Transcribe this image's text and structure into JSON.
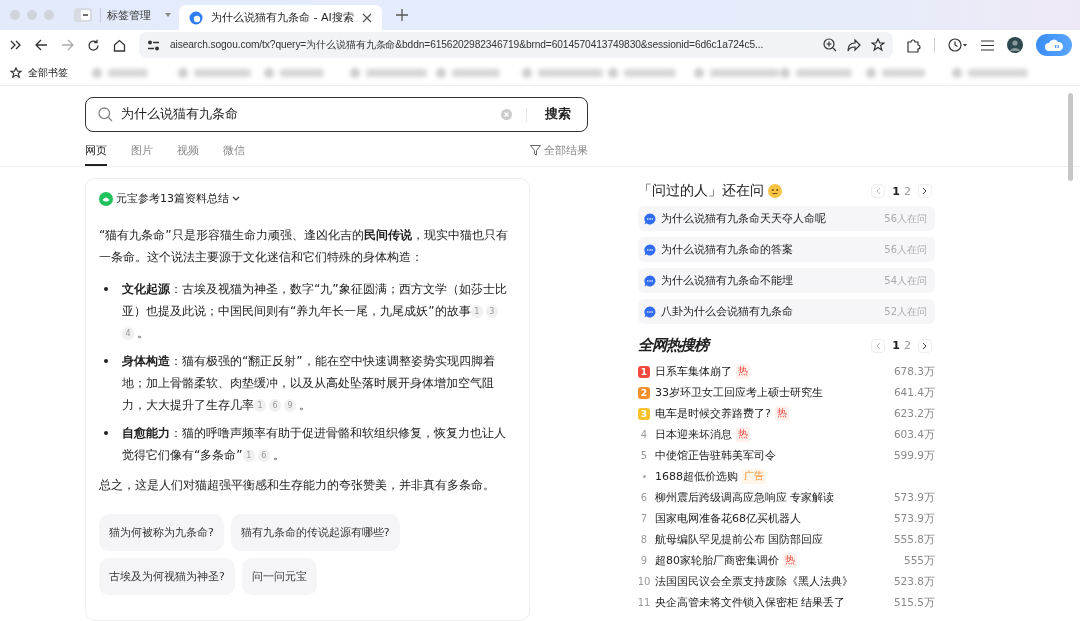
{
  "browser": {
    "tab_group": "标签管理",
    "tabs": [
      {
        "label": "为什么说猫有九条命 - AI搜索",
        "selected": true
      }
    ],
    "address": "aisearch.sogou.com/tx?query=为什么说猫有九条命&bddn=6156202982346719&brnd=6014570413749830&sessionid=6d6c1a724c5...",
    "bookmarks_label": "全部书签"
  },
  "search": {
    "value": "为什么说猫有九条命",
    "button": "搜索"
  },
  "filters": [
    {
      "label": "网页",
      "selected": true
    },
    {
      "label": "图片",
      "selected": false
    },
    {
      "label": "视频",
      "selected": false
    },
    {
      "label": "微信",
      "selected": false
    }
  ],
  "filter_all": "全部结果",
  "answer": {
    "header": "元宝参考13篇资料总结",
    "intro": "“猫有九条命”只是形容猫生命力顽强、逢凶化吉的**民间传说**，现实中猫也只有一条命。这个说法主要源于文化迷信和它们特殊的身体构造：",
    "bullets": [
      {
        "text": "**文化起源**：古埃及视猫为神圣，数字“九”象征圆满；西方文学（如莎士比亚）也提及此说；中国民间则有“养九年长一尾，九尾成妖”的故事",
        "refs": [
          "1",
          "3",
          "4"
        ],
        "end": "。"
      },
      {
        "text": "**身体构造**：猫有极强的“翻正反射”，能在空中快速调整姿势实现四脚着地；加上骨骼柔软、肉垫缓冲，以及从高处坠落时展开身体增加空气阻力，大大提升了生存几率",
        "refs": [
          "1",
          "6",
          "9"
        ],
        "end": "。"
      },
      {
        "text": "**自愈能力**：猫的呼噜声频率有助于促进骨骼和软组织修复，恢复力也让人觉得它们像有“多条命”",
        "refs": [
          "1",
          "6"
        ],
        "end": "。"
      }
    ],
    "summary": "总之，这是人们对猫超强平衡感和生存能力的夸张赞美，并非真有多条命。",
    "followups": [
      "猫为何被称为九条命?",
      "猫有九条命的传说起源有哪些?",
      "古埃及为何视猫为神圣?",
      "问一问元宝"
    ]
  },
  "asked": {
    "title": "「问过的人」还在问",
    "pages": [
      {
        "label": "1",
        "selected": true
      },
      {
        "label": "2",
        "selected": false
      }
    ],
    "items": [
      {
        "text": "为什么说猫有九条命天天夺人命呢",
        "count": "56人在问"
      },
      {
        "text": "为什么说猫有九条命的答案",
        "count": "56人在问"
      },
      {
        "text": "为什么说猫有九条命不能埋",
        "count": "54人在问"
      },
      {
        "text": "八卦为什么会说猫有九条命",
        "count": "52人在问"
      }
    ]
  },
  "hot": {
    "title": "全网热搜榜",
    "pages": [
      {
        "label": "1",
        "selected": true
      },
      {
        "label": "2",
        "selected": false
      }
    ],
    "items": [
      {
        "kind": "top",
        "rank": "1",
        "color": "#f04a3e",
        "text": "日系车集体崩了",
        "badge": "热",
        "count": "678.3万"
      },
      {
        "kind": "top",
        "rank": "2",
        "color": "#f7902b",
        "text": "33岁环卫女工回应考上硕士研究生",
        "count": "641.4万"
      },
      {
        "kind": "top",
        "rank": "3",
        "color": "#f7c22b",
        "text": "电车是时候交养路费了?",
        "badge": "热",
        "count": "623.2万"
      },
      {
        "kind": "plain",
        "rank": "4",
        "text": "日本迎来坏消息",
        "badge": "热",
        "count": "603.4万"
      },
      {
        "kind": "plain",
        "rank": "5",
        "text": "中使馆正告驻韩美军司令",
        "count": "599.9万"
      },
      {
        "kind": "ad",
        "text": "1688超低价选购",
        "badge": "广告"
      },
      {
        "kind": "plain",
        "rank": "6",
        "text": "柳州震后跨级调高应急响应 专家解读",
        "count": "573.9万"
      },
      {
        "kind": "plain",
        "rank": "7",
        "text": "国家电网准备花68亿买机器人",
        "count": "573.9万"
      },
      {
        "kind": "plain",
        "rank": "8",
        "text": "航母编队罕见提前公布 国防部回应",
        "count": "555.8万"
      },
      {
        "kind": "plain",
        "rank": "9",
        "text": "超80家轮胎厂商密集调价",
        "badge": "热",
        "count": "555万"
      },
      {
        "kind": "plain",
        "rank": "10",
        "text": "法国国民议会全票支持废除《黑人法典》",
        "count": "523.8万"
      },
      {
        "kind": "plain",
        "rank": "11",
        "text": "央企高管未将文件锁入保密柜 结果丢了",
        "count": "515.5万"
      }
    ]
  }
}
